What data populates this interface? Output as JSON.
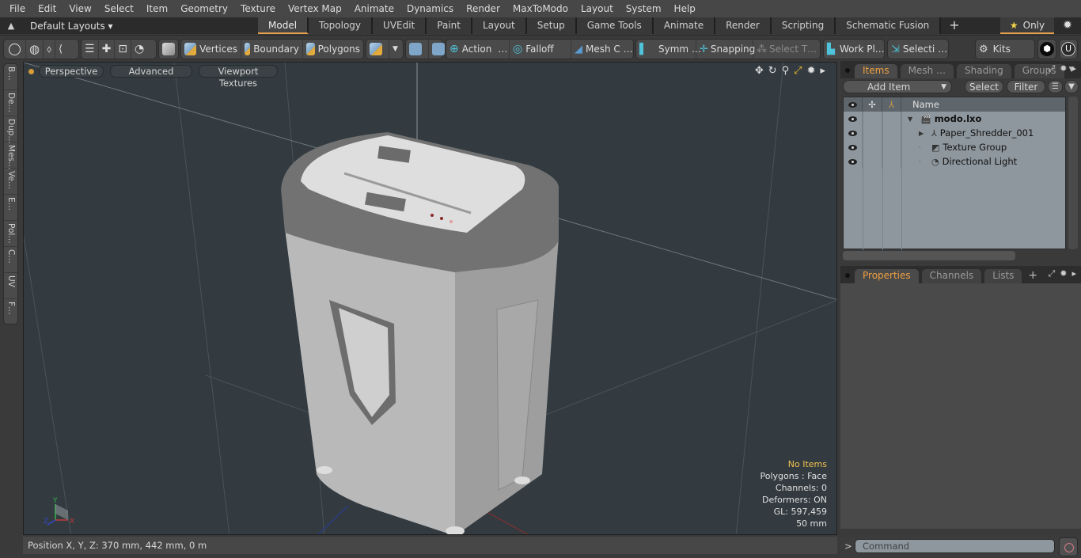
{
  "menu": [
    "File",
    "Edit",
    "View",
    "Select",
    "Item",
    "Geometry",
    "Texture",
    "Vertex Map",
    "Animate",
    "Dynamics",
    "Render",
    "MaxToModo",
    "Layout",
    "System",
    "Help"
  ],
  "layout": {
    "layouts_label": "Default Layouts ▾",
    "tabs": [
      "Model",
      "Topology",
      "UVEdit",
      "Paint",
      "Layout",
      "Setup",
      "Game Tools",
      "Animate",
      "Render",
      "Scripting",
      "Schematic Fusion"
    ],
    "active_tab": "Model",
    "add_tab": "+",
    "only_label": "Only",
    "star": "★"
  },
  "toolbar": {
    "vertices": "Vertices",
    "boundary": "Boundary",
    "polygons": "Polygons",
    "action": "Action",
    "falloff": "Falloff",
    "mesh_c": "Mesh C …",
    "symm": "Symm …",
    "snapping": "Snapping",
    "select_t": "Select T…",
    "work_pl": "Work Pl…",
    "selecti": "Selecti …",
    "kits": "Kits",
    "ellipsis": "…"
  },
  "left_tabs": [
    "B…",
    "De…",
    "Dup…",
    "Mes…",
    "Ve…",
    "E…",
    "Pol…",
    "C…",
    "UV",
    "F…"
  ],
  "viewport": {
    "view_mode": "Perspective",
    "shading": "Advanced",
    "textures": "Viewport Textures",
    "hud": {
      "selection": "No Items",
      "polygons": "Polygons : Face",
      "channels": "Channels: 0",
      "deformers": "Deformers: ON",
      "gl": "GL: 597,459",
      "scale": "50 mm"
    },
    "axis_labels": {
      "x": "X",
      "y": "Y",
      "z": "Z"
    }
  },
  "status": {
    "position": "Position X, Y, Z:   370 mm, 442 mm, 0 m"
  },
  "items_panel": {
    "tabs": [
      "Items",
      "Mesh …",
      "Shading",
      "Groups"
    ],
    "active_tab": "Items",
    "add_item": "Add Item",
    "select": "Select",
    "filter": "Filter",
    "column_name": "Name",
    "rows": [
      {
        "name": "modo.lxo",
        "level": 0,
        "expanded": true,
        "bold": true,
        "icon": "scene-icon"
      },
      {
        "name": "Paper_Shredder_001",
        "level": 1,
        "expanded": false,
        "bold": false,
        "icon": "locator-icon"
      },
      {
        "name": "Texture Group",
        "level": 1,
        "expanded": null,
        "bold": false,
        "icon": "texture-group-icon"
      },
      {
        "name": "Directional Light",
        "level": 1,
        "expanded": null,
        "bold": false,
        "icon": "light-icon"
      }
    ]
  },
  "properties_panel": {
    "tabs": [
      "Properties",
      "Channels",
      "Lists"
    ],
    "active_tab": "Properties",
    "add": "+"
  },
  "command": {
    "placeholder": "Command",
    "prompt": ">"
  }
}
